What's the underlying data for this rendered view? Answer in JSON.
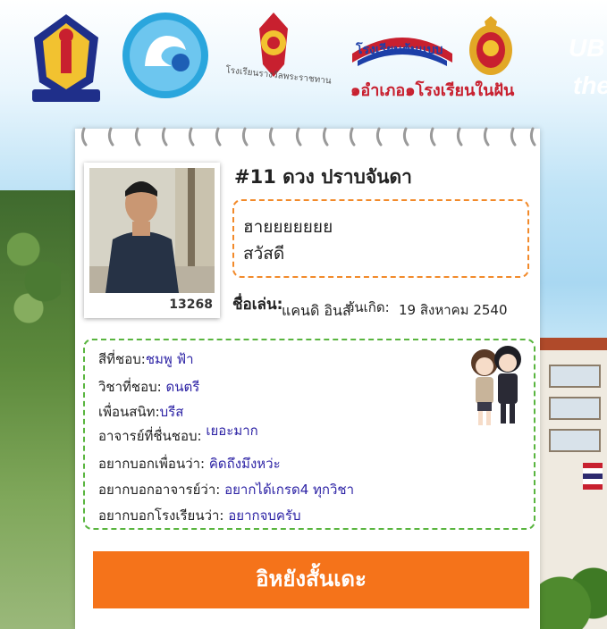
{
  "header": {
    "logo1_caption": "",
    "logo3_caption": "โรงเรียนรางวัลพระราชทาน",
    "logo4_title": "โรงเรียนต้นแบบ",
    "logo4_subtitle": "๑อำเภอ๑โรงเรียนในฝัน",
    "banner_line1": "UB",
    "banner_line2": "the"
  },
  "student": {
    "title": "#11 ดวง ปราบจันดา",
    "photo_id": "13268",
    "message_line1": "ฮายยยยยยย",
    "message_line2": "สวัสดี",
    "nickname_label": "ชื่อเล่น:",
    "nickname": "แคนดิ อินสั",
    "birthday_label": "วันเกิด:",
    "birthday": "19 สิงหาคม 2540"
  },
  "favorites": {
    "color_label": "สีที่ชอบ:",
    "color": "ชมพู ฟ้า",
    "subject_label": "วิชาที่ชอบ:",
    "subject": "ดนตรี",
    "friend_label": "เพื่อนสนิท:",
    "friend": "บรีส",
    "teacher_label": "อาจารย์ที่ชื่นชอบ:",
    "teacher": "เยอะมาก",
    "to_friends_label": "อยากบอกเพื่อนว่า:",
    "to_friends": "คิดถึงมึงหว่ะ",
    "to_teachers_label": "อยากบอกอาจารย์ว่า:",
    "to_teachers": "อยากได้เกรด4 ทุกวิชา",
    "to_school_label": "อยากบอกโรงเรียนว่า:",
    "to_school": "อยากจบครับ"
  },
  "cta": {
    "label": "อิหยังสั้นเดะ"
  },
  "colors": {
    "accent_orange": "#f5731a",
    "dash_orange": "#f28a2a",
    "dash_green": "#59b53f",
    "value_blue": "#2d23a5"
  }
}
